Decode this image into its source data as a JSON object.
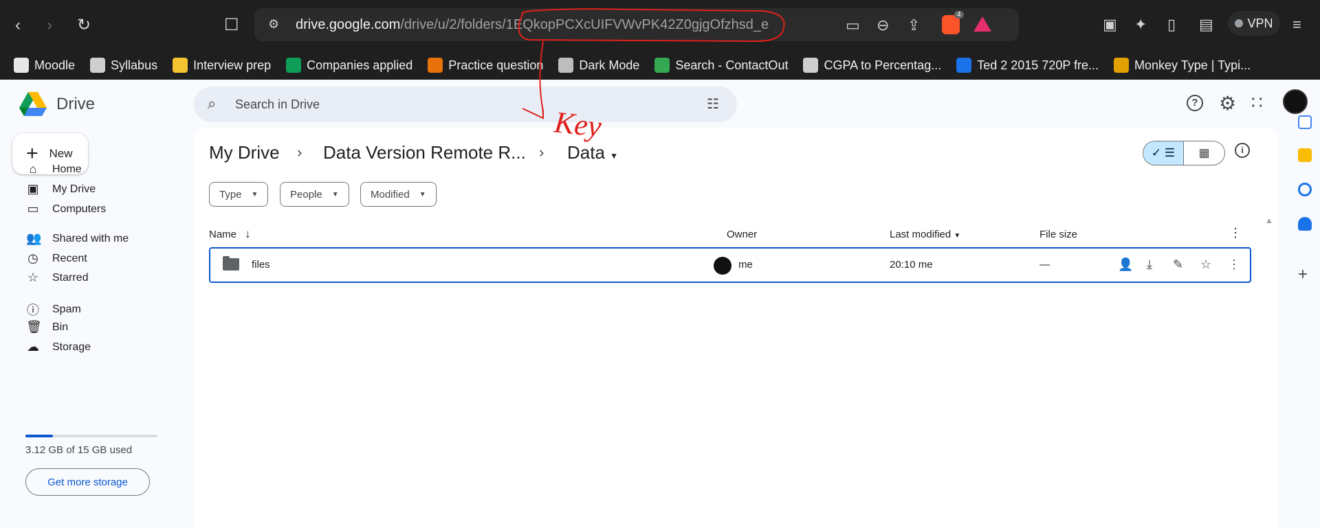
{
  "browser": {
    "url_host": "drive.google.com",
    "url_path": "/drive/u/2/folders/",
    "url_id": "1EQkopPCXcUIFVWvPK42Z0gjgOfzhsd_e",
    "vpn_label": "VPN",
    "brave_badge": "4"
  },
  "bookmarks": [
    {
      "label": "Moodle",
      "color": "#e8e8e8"
    },
    {
      "label": "Syllabus",
      "color": "#cfcfcf"
    },
    {
      "label": "Interview prep",
      "color": "#f4c430"
    },
    {
      "label": "Companies applied",
      "color": "#0f9d58"
    },
    {
      "label": "Practice question",
      "color": "#e8710a"
    },
    {
      "label": "Dark Mode",
      "color": "#bdbdbd"
    },
    {
      "label": "Search - ContactOut",
      "color": "#34a853"
    },
    {
      "label": "CGPA to Percentag...",
      "color": "#cfcfcf"
    },
    {
      "label": "Ted 2 2015 720P fre...",
      "color": "#1a73e8"
    },
    {
      "label": "Monkey Type | Typi...",
      "color": "#e2a100"
    }
  ],
  "drive": {
    "logo_text": "Drive",
    "search_placeholder": "Search in Drive",
    "new_label": "New",
    "sidebar": [
      {
        "label": "Home",
        "icon": "home-icon",
        "glyph": "⌂"
      },
      {
        "label": "My Drive",
        "icon": "my-drive-icon",
        "glyph": "▣"
      },
      {
        "label": "Computers",
        "icon": "computers-icon",
        "glyph": "▭"
      },
      {
        "label": "Shared with me",
        "icon": "shared-icon",
        "glyph": "👥"
      },
      {
        "label": "Recent",
        "icon": "recent-icon",
        "glyph": "◷"
      },
      {
        "label": "Starred",
        "icon": "star-icon",
        "glyph": "☆"
      },
      {
        "label": "Spam",
        "icon": "spam-icon",
        "glyph": "ⓘ"
      },
      {
        "label": "Bin",
        "icon": "bin-icon",
        "glyph": "🗑"
      },
      {
        "label": "Storage",
        "icon": "cloud-icon",
        "glyph": "☁"
      }
    ],
    "storage_used_fraction": 0.208,
    "storage_text": "3.12 GB of 15 GB used",
    "get_storage_label": "Get more storage"
  },
  "breadcrumb": {
    "items": [
      "My Drive",
      "Data Version Remote R...",
      "Data"
    ]
  },
  "filters": [
    "Type",
    "People",
    "Modified"
  ],
  "table": {
    "headers": {
      "name": "Name",
      "owner": "Owner",
      "modified": "Last modified",
      "size": "File size"
    },
    "rows": [
      {
        "name": "files",
        "owner": "me",
        "modified": "20:10 me",
        "size": "—"
      }
    ]
  },
  "annotation": {
    "text": "Key",
    "color": "#e0201b"
  },
  "colors": {
    "accent": "#0b57d0",
    "selected_view": "#c2e7ff"
  }
}
